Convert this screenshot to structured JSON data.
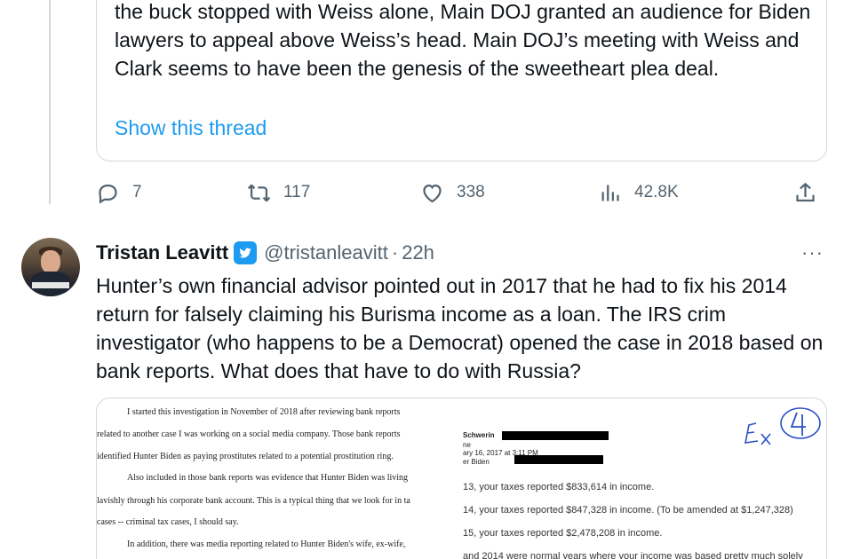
{
  "previous_tweet": {
    "text": "the buck stopped with Weiss alone, Main DOJ granted an audience for Biden lawyers to appeal above Weiss’s head. Main DOJ’s meeting with Weiss and Clark seems to have been the genesis of the sweetheart plea deal.",
    "show_thread": "Show this thread",
    "actions": {
      "replies": "7",
      "retweets": "117",
      "likes": "338",
      "views": "42.8K"
    }
  },
  "tweet": {
    "name": "Tristan Leavitt",
    "handle": "@tristanleavitt",
    "separator": "·",
    "time": "22h",
    "more": "···",
    "text": "Hunter’s own financial advisor pointed out in 2017 that he had to fix his 2014 return for falsely claiming his Burisma income as a loan. The IRS crim investigator (who happens to be a Democrat) opened the case in 2018 based on bank reports. What does that have to do with Russia?",
    "media": {
      "left_lines": [
        "I started this investigation in November of 2018 after reviewing bank reports",
        "related to another case I was working on a social media company.    Those bank reports",
        "identified Hunter Biden as paying prostitutes related to a potential prostitution ring.",
        "Also included in those bank reports was evidence that Hunter Biden was living",
        "lavishly through his corporate bank account.    This is a typical thing that we look for in ta",
        "cases -- criminal tax cases, I should say.",
        "In addition, there was media reporting related to Hunter Biden's wife, ex-wife,"
      ],
      "right_header": [
        "Schwerin",
        "ne",
        "ary 16, 2017 at 3:11 PM",
        "er Biden"
      ],
      "right_lines": [
        "13, your taxes reported $833,614 in income.",
        "14, your taxes reported $847,328 in income.  (To be amended at $1,247,328)",
        "15, your taxes reported $2,478,208 in income.",
        "and 2014 were normal years where your income was based pretty much solely"
      ],
      "annotation": "Ex 4"
    }
  },
  "colors": {
    "accent": "#1d9bf0",
    "secondary_text": "#536471",
    "border": "#cfd9de"
  }
}
